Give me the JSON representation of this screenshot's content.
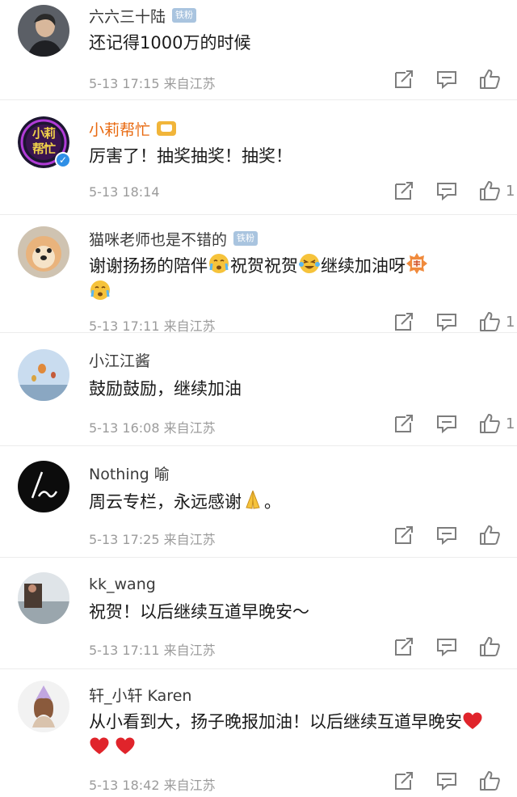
{
  "comments": [
    {
      "name": "六六三十陆",
      "badge": "铁粉",
      "text": "还记得1000万的时候",
      "date": "5-13 17:15",
      "source": "来自江苏",
      "likes": ""
    },
    {
      "name": "小莉帮忙",
      "text": "厉害了！抽奖抽奖！抽奖！",
      "date": "5-13 18:14",
      "source": "",
      "likes": "1",
      "avatar_text": "小莉帮忙"
    },
    {
      "name": "猫咪老师也是不错的",
      "badge": "铁粉",
      "text_a": "谢谢扬扬的陪伴",
      "text_b": "祝贺祝贺",
      "text_c": "继续加油呀",
      "date": "5-13 17:11",
      "source": "来自江苏",
      "likes": "1"
    },
    {
      "name": "小江江酱",
      "text": "鼓励鼓励，继续加油",
      "date": "5-13 16:08",
      "source": "来自江苏",
      "likes": "1"
    },
    {
      "name": "Nothing 喻",
      "text": "周云专栏，永远感谢",
      "text_end": "。",
      "date": "5-13 17:25",
      "source": "来自江苏",
      "likes": ""
    },
    {
      "name": "kk_wang",
      "text": "祝贺！以后继续互道早晚安～",
      "date": "5-13 17:11",
      "source": "来自江苏",
      "likes": ""
    },
    {
      "name": "轩_小轩 Karen",
      "text": "从小看到大，扬子晚报加油！以后继续互道早晚安",
      "date": "5-13 18:42",
      "source": "来自江苏",
      "likes": ""
    }
  ],
  "icons": {
    "share": "share-icon",
    "reply": "comment-icon",
    "like": "thumbs-up-icon"
  },
  "colors": {
    "vip_name": "#e8680e",
    "fan_badge": "#a9c4df",
    "meta": "#9b9b9b",
    "verified": "#2f8fe6",
    "heart": "#e0242b"
  }
}
